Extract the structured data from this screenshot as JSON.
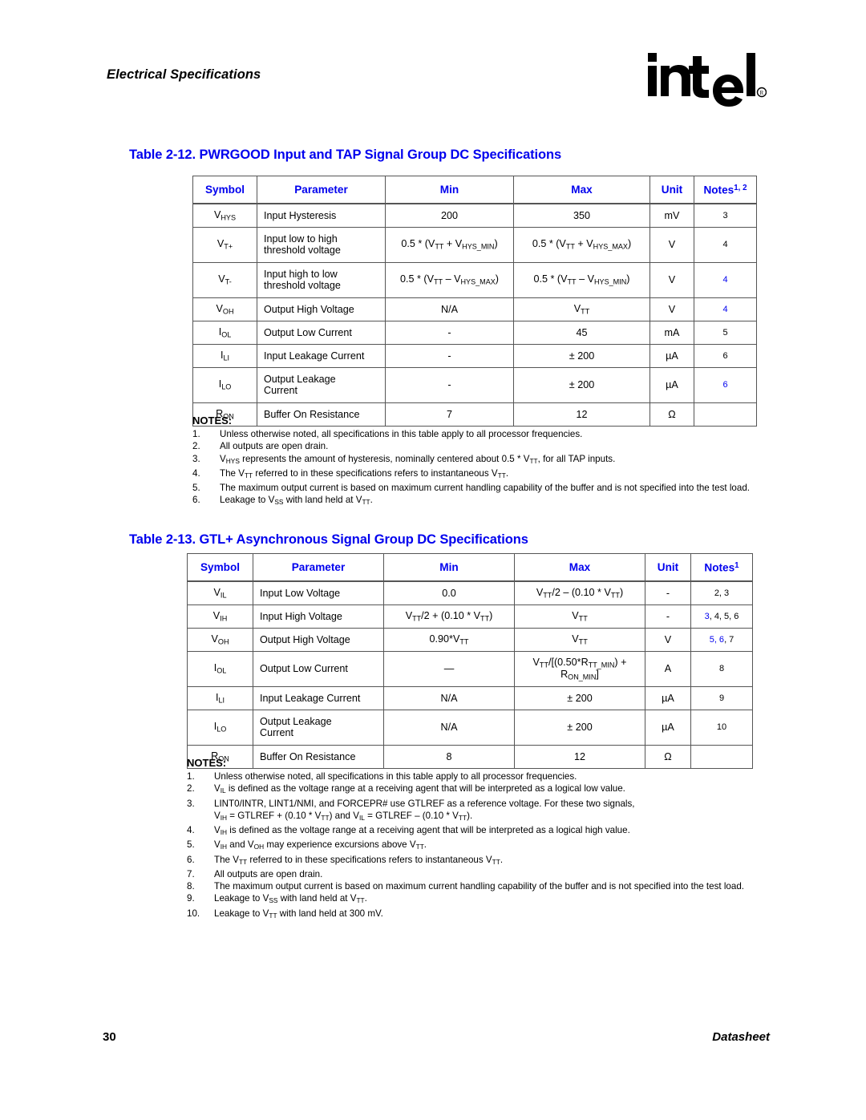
{
  "header": {
    "chapter_title": "Electrical Specifications",
    "logo_text": "intel",
    "logo_mark": "registered-trademark"
  },
  "table_212": {
    "title": "Table 2-12. PWRGOOD Input and TAP Signal Group DC Specifications",
    "columns": [
      "Symbol",
      "Parameter",
      "Min",
      "Max",
      "Unit",
      "Notes"
    ],
    "notes_superscript": "1, 2",
    "rows": [
      {
        "symbol_base": "V",
        "symbol_sub": "HYS",
        "parameter": "Input Hysteresis",
        "min": "200",
        "max": "350",
        "unit": "mV",
        "notes": "3",
        "notes_color": "black"
      },
      {
        "symbol_base": "V",
        "symbol_sub": "T+",
        "parameter": "Input low to high threshold voltage",
        "min": "0.5 * (VTT + VHYS_MIN)",
        "max": "0.5 * (VTT + VHYS_MAX)",
        "unit": "V",
        "notes": "4",
        "notes_color": "black"
      },
      {
        "symbol_base": "V",
        "symbol_sub": "T-",
        "parameter": "Input high to low threshold voltage",
        "min": "0.5 * (VTT – VHYS_MAX)",
        "max": "0.5 * (VTT – VHYS_MIN)",
        "unit": "V",
        "notes": "4",
        "notes_color": "blue"
      },
      {
        "symbol_base": "V",
        "symbol_sub": "OH",
        "parameter": "Output High Voltage",
        "min": "N/A",
        "max": "VTT",
        "unit": "V",
        "notes": "4",
        "notes_color": "blue"
      },
      {
        "symbol_base": "I",
        "symbol_sub": "OL",
        "parameter": "Output Low Current",
        "min": "-",
        "max": "45",
        "unit": "mA",
        "notes": "5",
        "notes_color": "black"
      },
      {
        "symbol_base": "I",
        "symbol_sub": "LI",
        "parameter": "Input Leakage Current",
        "min": "-",
        "max": "± 200",
        "unit": "µA",
        "notes": "6",
        "notes_color": "black"
      },
      {
        "symbol_base": "I",
        "symbol_sub": "LO",
        "parameter": "Output Leakage Current",
        "min": "-",
        "max": "± 200",
        "unit": "µA",
        "notes": "6",
        "notes_color": "blue"
      },
      {
        "symbol_base": "R",
        "symbol_sub": "ON",
        "parameter": "Buffer On Resistance",
        "min": "7",
        "max": "12",
        "unit": "Ω",
        "notes": "",
        "notes_color": "black"
      }
    ],
    "notes_heading": "NOTES:",
    "notes": [
      {
        "num": "1.",
        "text": "Unless otherwise noted, all specifications in this table apply to all processor frequencies."
      },
      {
        "num": "2.",
        "text": "All outputs are open drain."
      },
      {
        "num": "3.",
        "text": "VHYS represents the amount of hysteresis, nominally centered about 0.5 * VTT, for all TAP inputs."
      },
      {
        "num": "4.",
        "text": "The VTT referred to in these specifications refers to instantaneous VTT."
      },
      {
        "num": "5.",
        "text": "The maximum output current is based on maximum current handling capability of the buffer and is not specified into the test load."
      },
      {
        "num": "6.",
        "text": "Leakage to VSS with land held at VTT."
      }
    ]
  },
  "table_213": {
    "title": "Table 2-13. GTL+ Asynchronous Signal Group DC Specifications",
    "columns": [
      "Symbol",
      "Parameter",
      "Min",
      "Max",
      "Unit",
      "Notes"
    ],
    "notes_superscript": "1",
    "rows": [
      {
        "symbol_base": "V",
        "symbol_sub": "IL",
        "parameter": "Input Low Voltage",
        "min": "0.0",
        "max": "VTT/2 – (0.10 * VTT)",
        "unit": "-",
        "notes": "2, 3"
      },
      {
        "symbol_base": "V",
        "symbol_sub": "IH",
        "parameter": "Input High Voltage",
        "min": "VTT/2 + (0.10 * VTT)",
        "max": "VTT",
        "unit": "-",
        "notes": "3, 4, 5, 6"
      },
      {
        "symbol_base": "V",
        "symbol_sub": "OH",
        "parameter": "Output High Voltage",
        "min": "0.90*VTT",
        "max": "VTT",
        "unit": "V",
        "notes": "5, 6, 7"
      },
      {
        "symbol_base": "I",
        "symbol_sub": "OL",
        "parameter": "Output Low Current",
        "min": "—",
        "max": "VTT/[(0.50*RTT_MIN) + RON_MIN]",
        "unit": "A",
        "notes": "8"
      },
      {
        "symbol_base": "I",
        "symbol_sub": "LI",
        "parameter": "Input Leakage Current",
        "min": "N/A",
        "max": "± 200",
        "unit": "µA",
        "notes": "9"
      },
      {
        "symbol_base": "I",
        "symbol_sub": "LO",
        "parameter": "Output Leakage Current",
        "min": "N/A",
        "max": "± 200",
        "unit": "µA",
        "notes": "10"
      },
      {
        "symbol_base": "R",
        "symbol_sub": "ON",
        "parameter": "Buffer On Resistance",
        "min": "8",
        "max": "12",
        "unit": "Ω",
        "notes": ""
      }
    ],
    "notes_heading": "NOTES:",
    "notes": [
      {
        "num": "1.",
        "text": "Unless otherwise noted, all specifications in this table apply to all processor frequencies."
      },
      {
        "num": "2.",
        "text": "VIL is defined as the voltage range at a receiving agent that will be interpreted as a logical low value."
      },
      {
        "num": "3.",
        "text": "LINT0/INTR, LINT1/NMI, and FORCEPR# use GTLREF as a reference voltage. For these two signals,",
        "cont": "VIH = GTLREF + (0.10 * VTT) and VIL = GTLREF – (0.10 * VTT)."
      },
      {
        "num": "4.",
        "text": "VIH is defined as the voltage range at a receiving agent that will be interpreted as a logical high value."
      },
      {
        "num": "5.",
        "text": "VIH and VOH may experience excursions above VTT."
      },
      {
        "num": "6.",
        "text": "The VTT referred to in these specifications refers to instantaneous VTT."
      },
      {
        "num": "7.",
        "text": "All outputs are open drain."
      },
      {
        "num": "8.",
        "text": "The maximum output current is based on maximum current handling capability of the buffer and is not specified into the test load."
      },
      {
        "num": "9.",
        "text": "Leakage to VSS with land held at VTT."
      },
      {
        "num": "10.",
        "text": "Leakage to VTT with land held at 300 mV."
      }
    ]
  },
  "footer": {
    "page_number": "30",
    "doc_type": "Datasheet"
  },
  "colors": {
    "heading_blue": "#0000ee",
    "text_black": "#000000",
    "border_gray": "#555555"
  }
}
